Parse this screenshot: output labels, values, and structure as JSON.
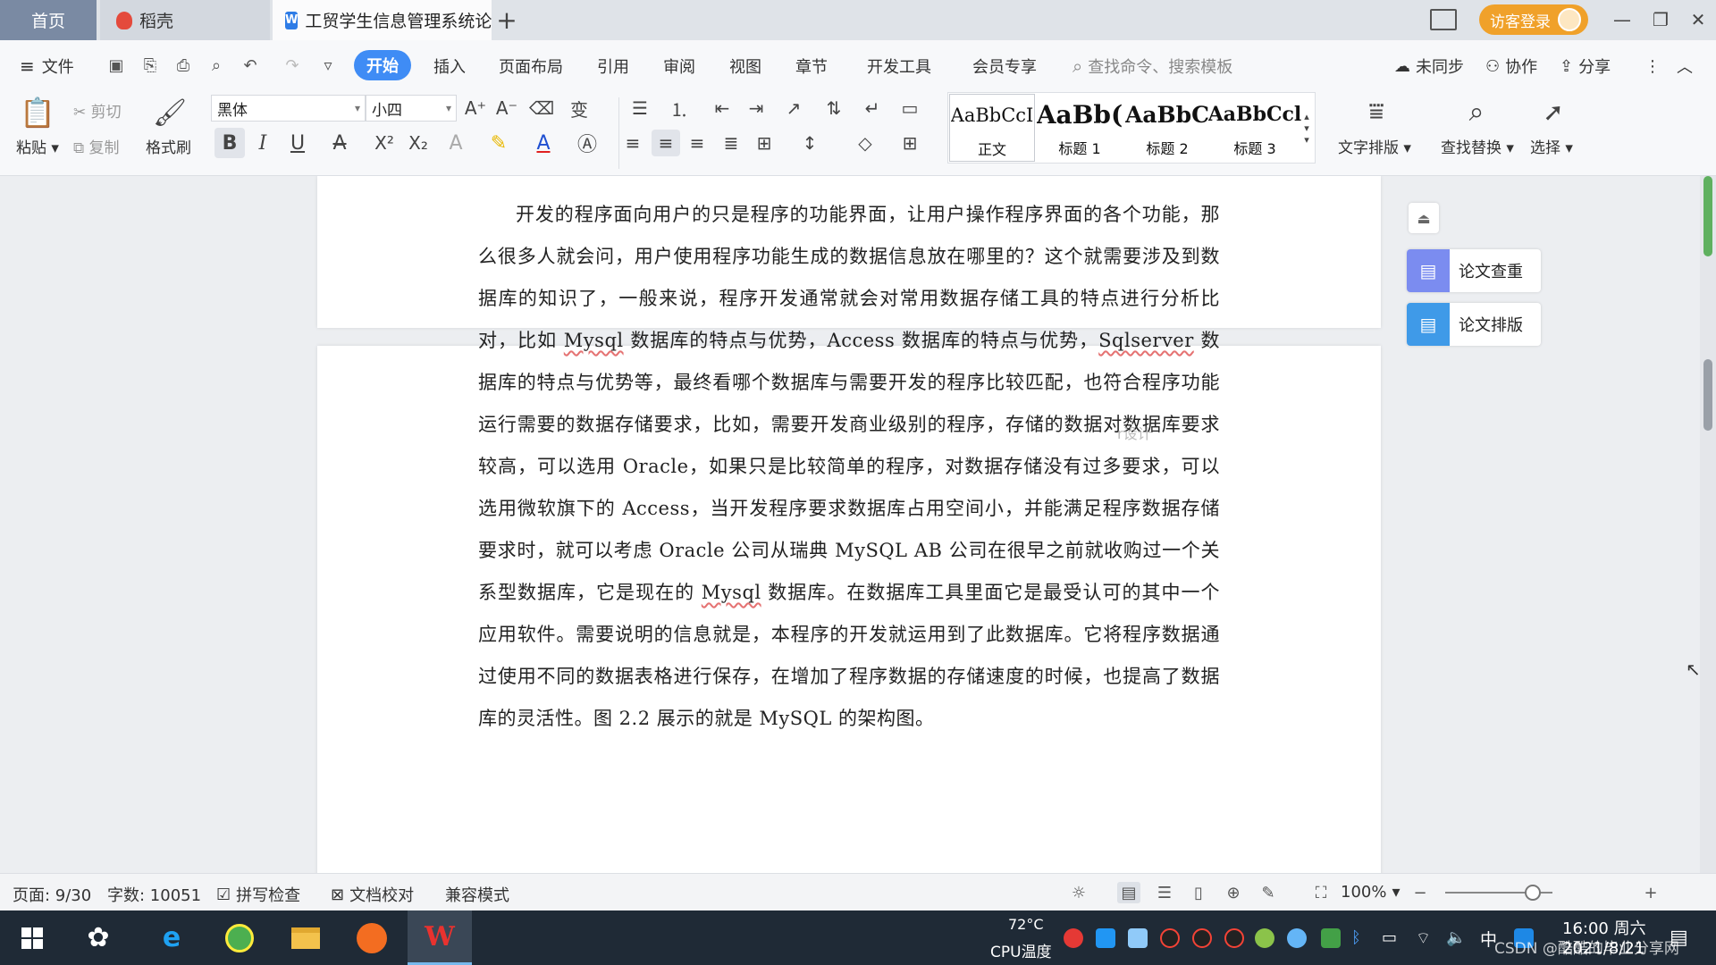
{
  "tabs": {
    "home": "首页",
    "daoke": "稻壳",
    "document": "工贸学生信息管理系统论",
    "login": "访客登录"
  },
  "menu": {
    "file": "文件",
    "items": [
      "开始",
      "插入",
      "页面布局",
      "引用",
      "审阅",
      "视图",
      "章节",
      "开发工具",
      "会员专享"
    ],
    "search_placeholder": "查找命令、搜索模板",
    "unsync": "未同步",
    "collab": "协作",
    "share": "分享"
  },
  "ribbon": {
    "paste": "粘贴",
    "cut": "剪切",
    "copy": "复制",
    "format_painter": "格式刷",
    "font_name": "黑体",
    "font_size": "小四",
    "styles": [
      {
        "sample": "AaBbCcI",
        "name": "正文"
      },
      {
        "sample": "AaBb(",
        "name": "标题 1"
      },
      {
        "sample": "AaBbC",
        "name": "标题 2"
      },
      {
        "sample": "AaBbCcl",
        "name": "标题 3"
      }
    ],
    "text_layout": "文字排版",
    "find_replace": "查找替换",
    "select": "选择"
  },
  "side_panel": {
    "check": "论文查重",
    "layout": "论文排版"
  },
  "document": {
    "paragraph_parts": [
      "开发的程序面向用户的只是程序的功能界面，让用户操作程序界面的各个功能，那么很多人就会问，用户使用程序功能生成的数据信息放在哪里的？这个就需要涉及到数据库的知识了，一般来说，程序开发通常就会对常用数据存储工具的特点进行分析比对，比如",
      "Mysql",
      "数据库的特点与优势，Access 数据库的特点与优势，",
      "Sqlserver",
      "数据库的特点与优势等，最终看哪个数据库与需要开发的程序比较匹配，也符合程序功能运行需要的数据存储要求，比如，需要开发商业级别的程序，存储的数据对数据库要求较高，可以选用 Oracle，如果只是比较简单的程序，对数据存储没有过多要求，可以选用微软旗下的 Access，当开发程序要求数据库占用空间小，并能满足程序数据存储要求时，就可以考虑 Oracle 公司从瑞典 MySQL AB 公司在很早之前就收购过一个关系型数据库，它是现在的",
      "Mysql",
      "数据库。在数据库工具里面它是最受认可的其中一个应用软件。需要说明的信息就是，本程序的开发就运用到了此数据库。它将程序数据通过使用不同的数据表格进行保存，在增加了程序数据的存储速度的时候，也提高了数据库的灵活性。图 2.2 展示的就是 MySQL 的架构图。"
    ],
    "ghost": "r设计"
  },
  "status": {
    "page": "页面: 9/30",
    "words": "字数: 10051",
    "spell": "拼写检查",
    "proof": "文档校对",
    "compat": "兼容模式",
    "zoom": "100%"
  },
  "taskbar": {
    "cpu_temp": "72°C",
    "cpu_label": "CPU温度",
    "ime": "中",
    "time": "16:00 周六",
    "date": "2021/8/21",
    "watermark": "CSDN @酷酷的毕业分享网"
  },
  "colors": {
    "accent": "#3f8cf5",
    "home_tab": "#7a8aa3",
    "login": "#f0a12a",
    "taskbar": "#1f2a36"
  }
}
